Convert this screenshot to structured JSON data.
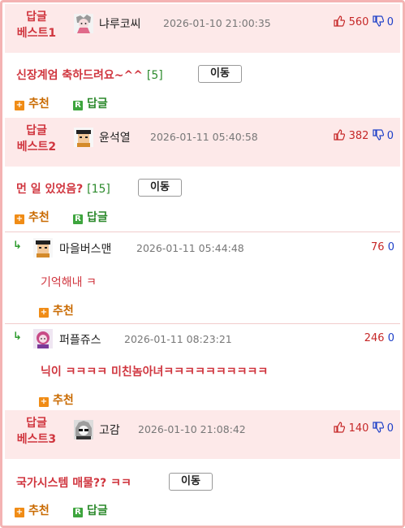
{
  "posts": [
    {
      "badge_line1": "답글",
      "badge_line2": "베스트1",
      "nick": "냐루코씨",
      "date": "2026-01-10 21:00:35",
      "up": "560",
      "down": "0",
      "text": "신장계엄 축하드려요~^^",
      "count": "[5]",
      "move_label": "이동",
      "recommend_label": "추천",
      "reply_label": "답글",
      "recommend_icon": "+",
      "reply_icon": "R"
    },
    {
      "badge_line1": "답글",
      "badge_line2": "베스트2",
      "nick": "윤석열",
      "date": "2026-01-11 05:40:58",
      "up": "382",
      "down": "0",
      "text": "먼 일 있었음?",
      "count": "[15]",
      "move_label": "이동",
      "recommend_label": "추천",
      "reply_label": "답글",
      "recommend_icon": "+",
      "reply_icon": "R"
    },
    {
      "badge_line1": "답글",
      "badge_line2": "베스트3",
      "nick": "고감",
      "date": "2026-01-10 21:08:42",
      "up": "140",
      "down": "0",
      "text": "국가시스템 매물?? ㅋㅋ",
      "move_label": "이동",
      "recommend_label": "추천",
      "reply_label": "답글",
      "recommend_icon": "+",
      "reply_icon": "R"
    }
  ],
  "replies": [
    {
      "arrow": "↳",
      "nick": "마을버스맨",
      "date": "2026-01-11 05:44:48",
      "up": "76",
      "down": "0",
      "text": "기억해내 ㅋ",
      "recommend_label": "추천",
      "recommend_icon": "+"
    },
    {
      "arrow": "↳",
      "nick": "퍼플쥬스",
      "date": "2026-01-11 08:23:21",
      "up": "246",
      "down": "0",
      "text": "닉이 ㅋㅋㅋㅋ 미친놈아녀ㅋㅋㅋㅋㅋㅋㅋㅋㅋㅋ",
      "recommend_label": "추천",
      "recommend_icon": "+"
    }
  ],
  "colors": {
    "accent_red": "#d0363f",
    "header_bg": "#fde9e9",
    "border": "#f4b3b3",
    "recommend_orange": "#f08c16",
    "reply_green": "#3ea53e",
    "down_blue": "#1e40c8"
  },
  "icons": {
    "thumb_up": "thumb-up-icon",
    "thumb_down": "thumb-down-icon",
    "reply_arrow": "reply-arrow-icon"
  }
}
